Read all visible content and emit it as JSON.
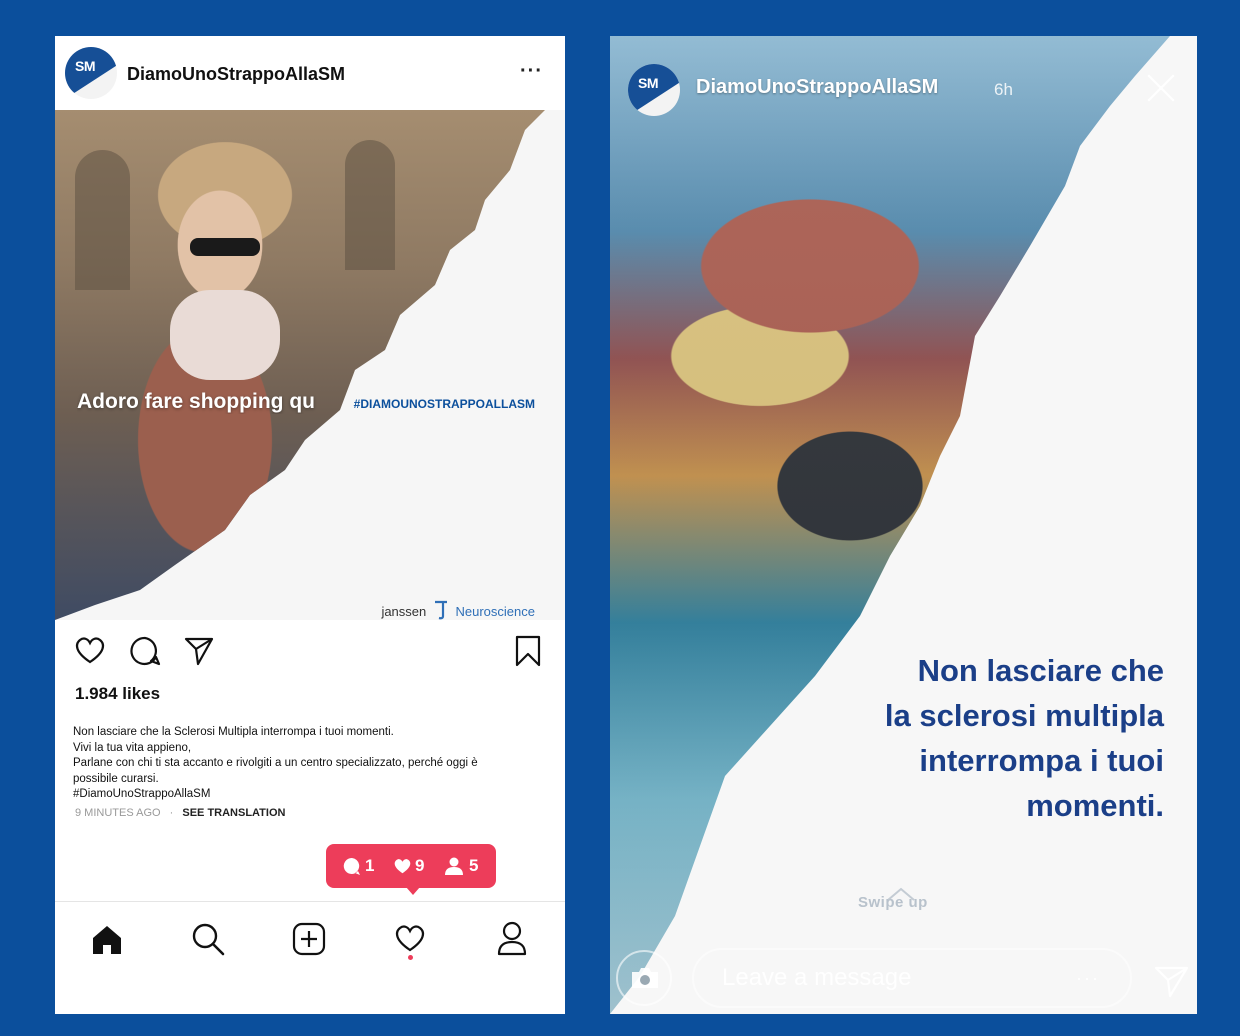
{
  "post": {
    "username": "DiamoUnoStrappoAllaSM",
    "avatar_text": "SM",
    "more_label": "···",
    "image": {
      "overlay_text": "Adoro fare shopping qu",
      "hashtag": "#DIAMOUNOSTRAPPOALLASM",
      "brand_primary": "janssen",
      "brand_secondary": "Neuroscience"
    },
    "likes": "1.984 likes",
    "caption": [
      "Non lasciare che la Sclerosi Multipla interrompa i tuoi momenti.",
      "Vivi la tua vita appieno,",
      "Parlane con chi ti sta accanto e rivolgiti a un centro specializzato, perché oggi è",
      "possibile curarsi.",
      "#DiamoUnoStrappoAllaSM"
    ],
    "time_ago": "9 MINUTES AGO",
    "see_translation": "SEE TRANSLATION",
    "notifications": {
      "comments": "1",
      "likes": "9",
      "followers": "5"
    },
    "icons": {
      "like": "heart-icon",
      "comment": "comment-icon",
      "share": "send-icon",
      "save": "bookmark-icon",
      "home": "home-icon",
      "search": "search-icon",
      "add": "add-post-icon",
      "activity": "heart-icon",
      "profile": "profile-icon"
    }
  },
  "story": {
    "username": "DiamoUnoStrappoAllaSM",
    "avatar_text": "SM",
    "time": "6h",
    "text_lines": [
      "Non lasciare che",
      "la sclerosi multipla",
      "interrompa i tuoi",
      "momenti."
    ],
    "swipe_label": "Swipe up",
    "message_placeholder": "Leave a message",
    "message_dots": "···",
    "icons": {
      "close": "close-icon",
      "camera": "camera-icon",
      "send": "send-icon"
    }
  },
  "colors": {
    "background": "#0b4f9c",
    "story_text": "#1b3f88",
    "notification": "#ed3d5a"
  }
}
